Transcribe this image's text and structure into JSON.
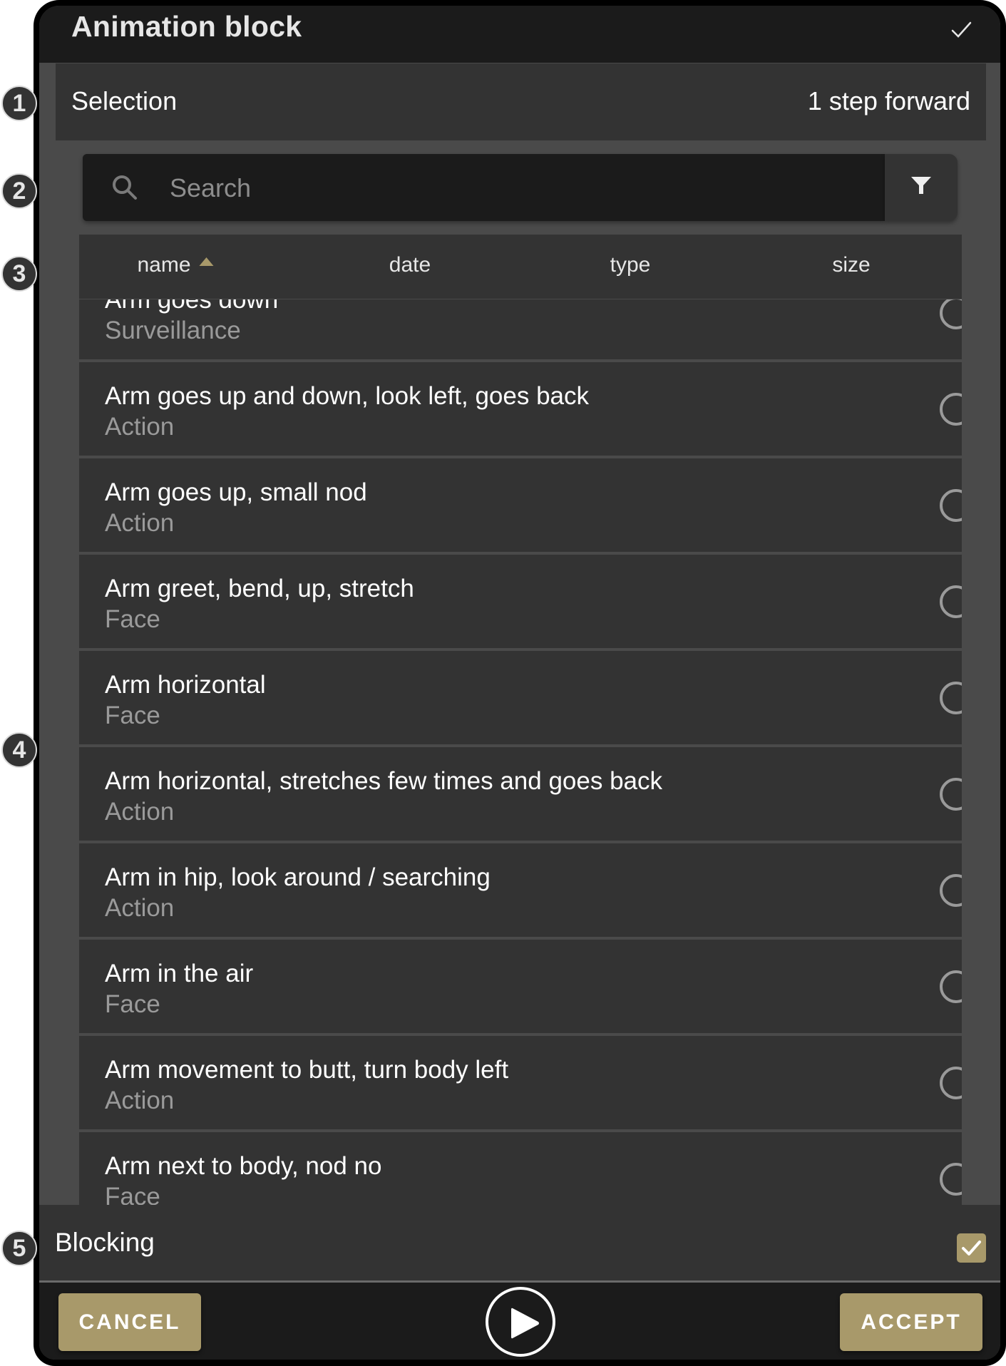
{
  "dialog": {
    "title": "Animation block",
    "confirm_icon": "check-icon"
  },
  "selection": {
    "label": "Selection",
    "value": "1 step forward"
  },
  "search": {
    "placeholder": "Search",
    "value": "",
    "search_icon": "search-icon",
    "filter_icon": "filter-icon"
  },
  "table": {
    "columns": [
      {
        "label": "name",
        "sorted": "ascending"
      },
      {
        "label": "date"
      },
      {
        "label": "type"
      },
      {
        "label": "size"
      }
    ],
    "rows": [
      {
        "title": "Arm goes down",
        "subtitle": "Surveillance",
        "selected": false
      },
      {
        "title": "Arm goes up and down, look left, goes back",
        "subtitle": "Action",
        "selected": false
      },
      {
        "title": "Arm goes up, small nod",
        "subtitle": "Action",
        "selected": false
      },
      {
        "title": "Arm greet, bend, up, stretch",
        "subtitle": "Face",
        "selected": false
      },
      {
        "title": "Arm horizontal",
        "subtitle": "Face",
        "selected": false
      },
      {
        "title": "Arm horizontal, stretches few times and goes back",
        "subtitle": "Action",
        "selected": false
      },
      {
        "title": "Arm in hip, look around / searching",
        "subtitle": "Action",
        "selected": false
      },
      {
        "title": "Arm in the air",
        "subtitle": "Face",
        "selected": false
      },
      {
        "title": "Arm movement to butt, turn body left",
        "subtitle": "Action",
        "selected": false
      },
      {
        "title": "Arm next to body, nod no",
        "subtitle": "Face",
        "selected": false
      }
    ]
  },
  "blocking": {
    "label": "Blocking",
    "checked": true
  },
  "footer": {
    "cancel_label": "CANCEL",
    "accept_label": "ACCEPT",
    "play_icon": "play-icon"
  },
  "annotations": [
    "1",
    "2",
    "3",
    "4",
    "5"
  ],
  "colors": {
    "accent": "#a8996a",
    "panel": "#333333",
    "background": "#4a4a4a",
    "titlebar": "#1b1b1b"
  }
}
